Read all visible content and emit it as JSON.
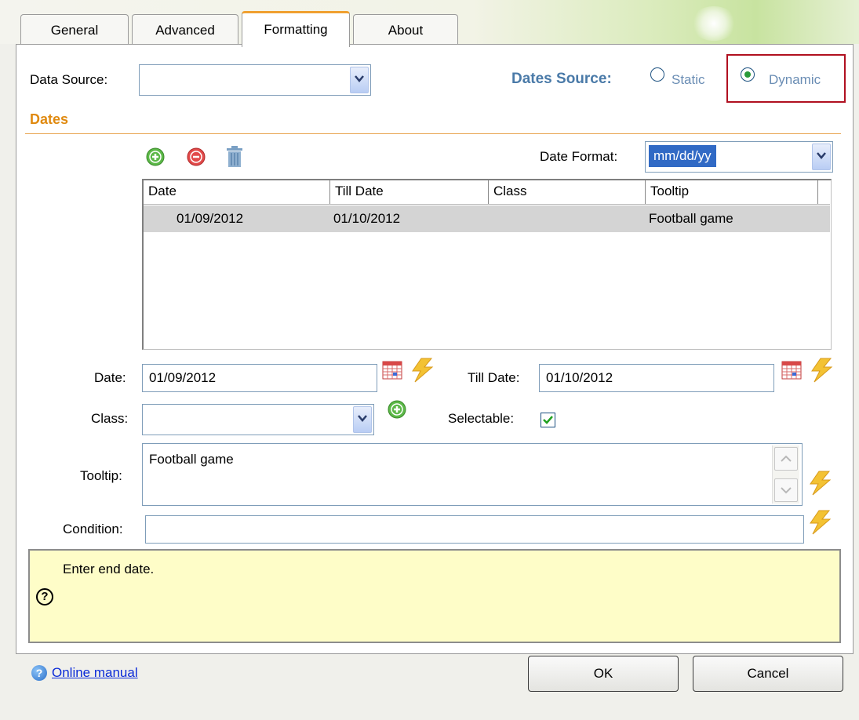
{
  "tabs": [
    {
      "label": "General"
    },
    {
      "label": "Advanced"
    },
    {
      "label": "Formatting"
    },
    {
      "label": "About"
    }
  ],
  "data_source": {
    "label": "Data Source:",
    "value": ""
  },
  "dates_source": {
    "label": "Dates Source:",
    "options": [
      {
        "label": "Static",
        "selected": false
      },
      {
        "label": "Dynamic",
        "selected": true
      }
    ]
  },
  "section_title": "Dates",
  "date_format": {
    "label": "Date Format:",
    "value": "mm/dd/yy"
  },
  "grid": {
    "columns": [
      "Date",
      "Till Date",
      "Class",
      "Tooltip"
    ],
    "rows": [
      {
        "date": "01/09/2012",
        "till_date": "01/10/2012",
        "class": "",
        "tooltip": "Football game"
      }
    ]
  },
  "form": {
    "date_label": "Date:",
    "date_value": "01/09/2012",
    "till_date_label": "Till Date:",
    "till_date_value": "01/10/2012",
    "class_label": "Class:",
    "class_value": "",
    "selectable_label": "Selectable:",
    "selectable_checked": true,
    "tooltip_label": "Tooltip:",
    "tooltip_value": "Football game",
    "condition_label": "Condition:",
    "condition_value": ""
  },
  "help": {
    "text": "Enter end date.",
    "icon": "?"
  },
  "footer": {
    "manual_link": "Online manual",
    "ok": "OK",
    "cancel": "Cancel"
  },
  "colors": {
    "accent": "#f0a030",
    "section": "#e08a10",
    "highlight_box": "#b01020",
    "help_bg": "#fefdc8"
  }
}
